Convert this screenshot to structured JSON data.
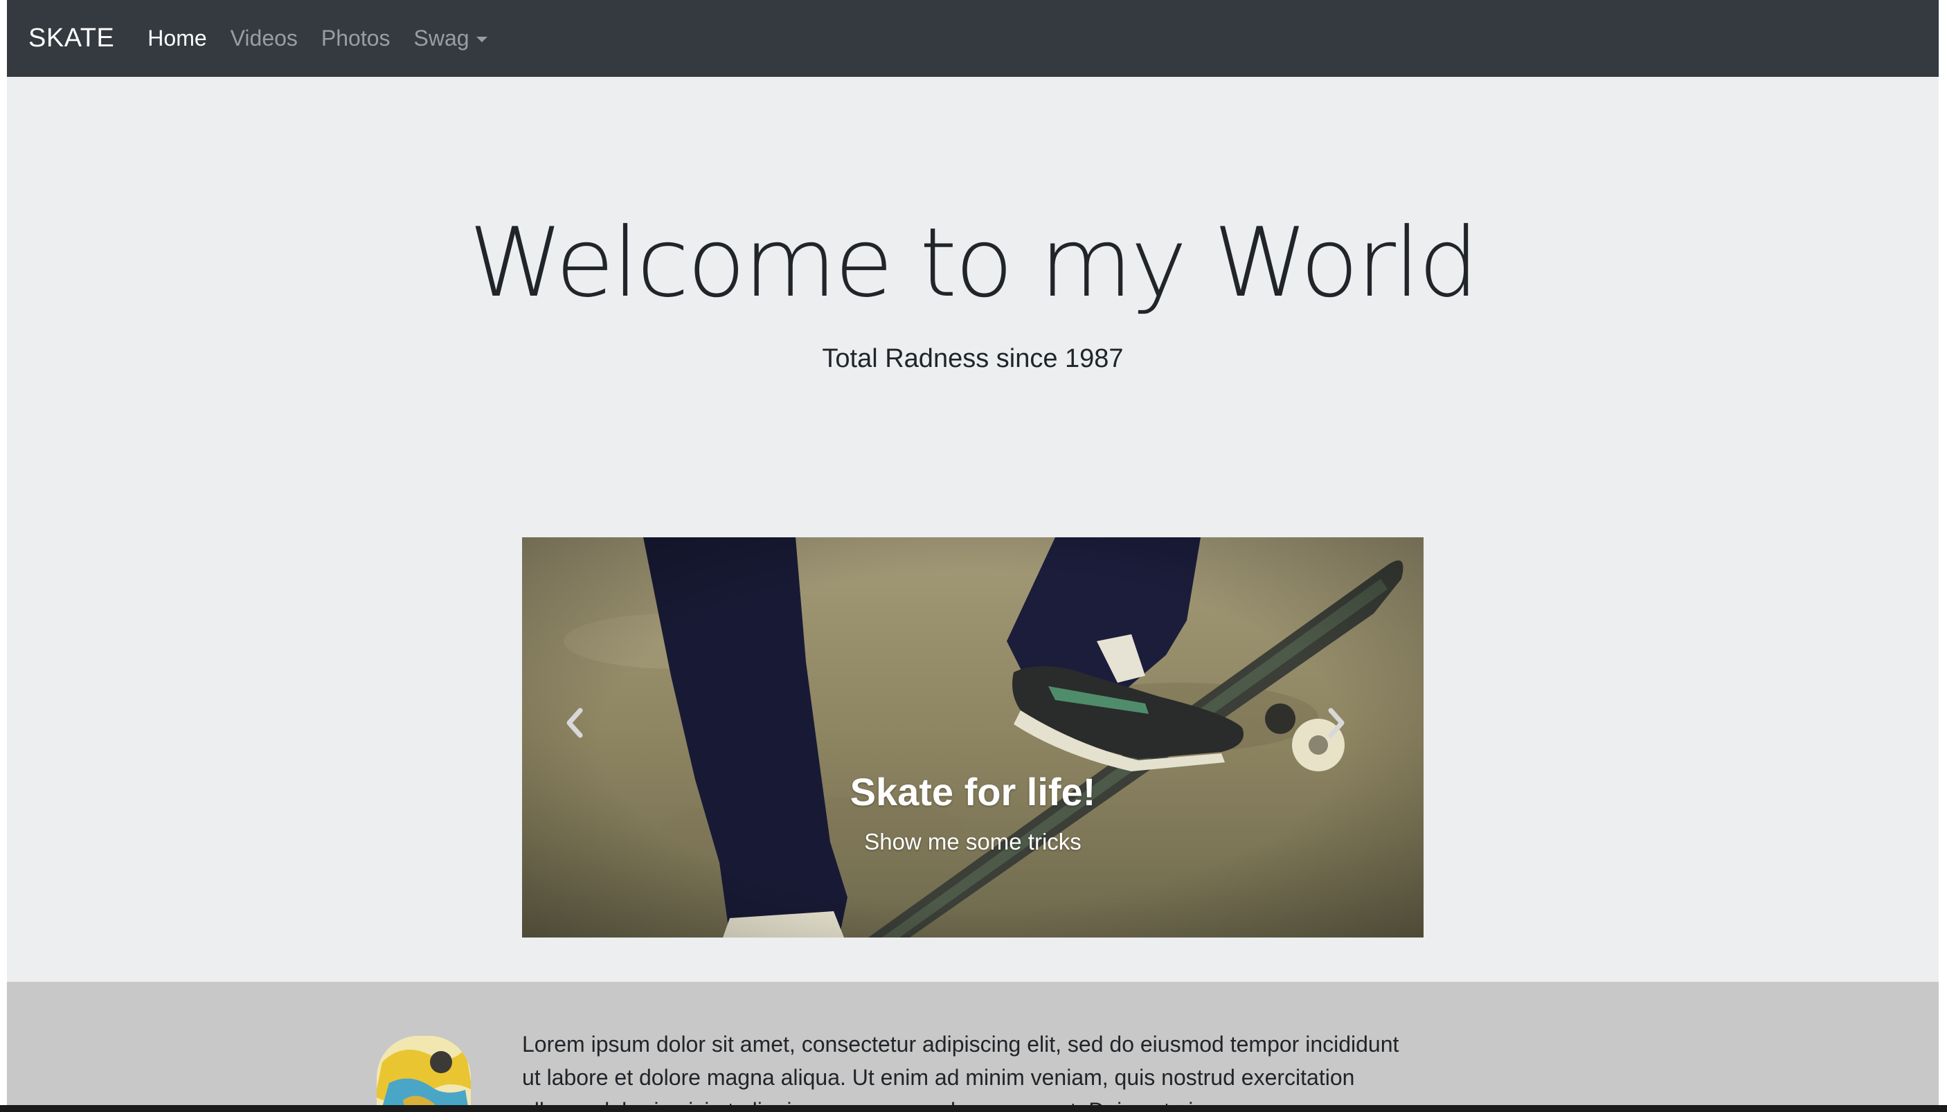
{
  "navbar": {
    "brand": "SKATE",
    "items": [
      {
        "label": "Home",
        "active": true
      },
      {
        "label": "Videos"
      },
      {
        "label": "Photos"
      },
      {
        "label": "Swag",
        "dropdown": true
      }
    ]
  },
  "jumbotron": {
    "title": "Welcome to my World",
    "subtitle": "Total Radness since 1987"
  },
  "carousel": {
    "caption_title": "Skate for life!",
    "caption_text": "Show me some tricks",
    "prev_icon": "chevron-left-icon",
    "next_icon": "chevron-right-icon"
  },
  "feature": {
    "text": "Lorem ipsum dolor sit amet, consectetur adipiscing elit, sed do eiusmod tempor incididunt ut labore et dolore magna aliqua. Ut enim ad minim veniam, quis nostrud exercitation ullamco laboris nisi ut aliquip ex ea commodo consequat. Duis aute irure"
  },
  "colors": {
    "navbar": "#343a40",
    "page_background": "#eceef0",
    "feature_background": "#c8c8c8",
    "text": "#212529"
  }
}
